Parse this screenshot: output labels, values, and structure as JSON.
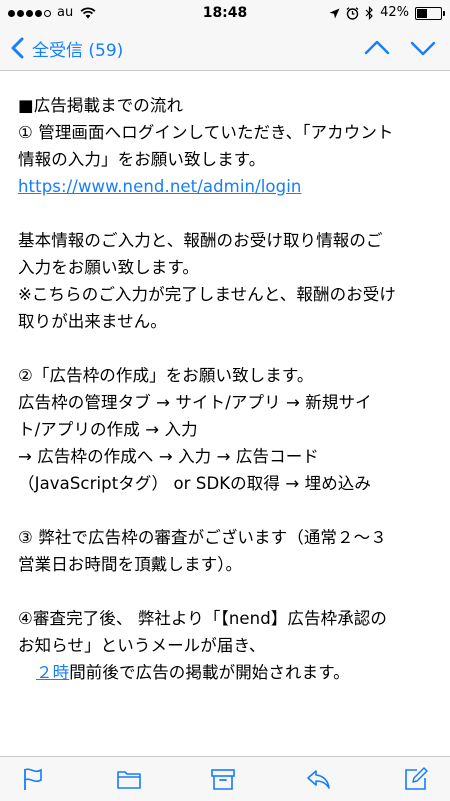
{
  "status_bar": {
    "carrier": "au",
    "time": "18:48",
    "battery_percent": "42%",
    "battery_level": 0.42,
    "signal_dots": 4
  },
  "nav": {
    "back_label": "全受信 (59)",
    "back_icon": "chevron-left-icon",
    "prev_icon": "chevron-up-icon",
    "next_icon": "chevron-down-icon"
  },
  "message": {
    "heading": "■広告掲載までの流れ",
    "step1_line1": "① 管理画面へログインしていただき、「アカウント",
    "step1_line2": "情報の入力」をお願い致します。",
    "step1_link": "https://www.nend.net/admin/login",
    "info_line1": "基本情報のご入力と、報酬のお受け取り情報のご",
    "info_line2": "入力をお願い致します。",
    "note_line1": "※こちらのご入力が完了しませんと、報酬のお受け",
    "note_line2": "取りが出来ません。",
    "step2_line1": "②「広告枠の作成」をお願い致します。",
    "step2_line2": "広告枠の管理タブ → サイト/アプリ → 新規サイ",
    "step2_line3": "ト/アプリの作成 → 入力",
    "step2_line4": "→ 広告枠の作成へ → 入力 → 広告コード",
    "step2_line5": "（JavaScriptタグ） or SDKの取得 → 埋め込み",
    "step3_line1": "③ 弊社で広告枠の審査がございます（通常２～３",
    "step3_line2": "営業日お時間を頂戴します）。",
    "step4_line1": "④審査完了後、 弊社より「【nend】広告枠承認の",
    "step4_line2": "お知らせ」というメールが届き、",
    "step4_link": "２時",
    "step4_line3_rest": "間前後で広告の掲載が開始されます。"
  },
  "toolbar": {
    "flag_icon": "flag-icon",
    "folder_icon": "folder-icon",
    "archive_icon": "archive-icon",
    "reply_icon": "reply-icon",
    "compose_icon": "compose-icon"
  },
  "colors": {
    "accent": "#157efb",
    "bar_background": "#f7f7f7",
    "separator": "#c8c8cc"
  }
}
